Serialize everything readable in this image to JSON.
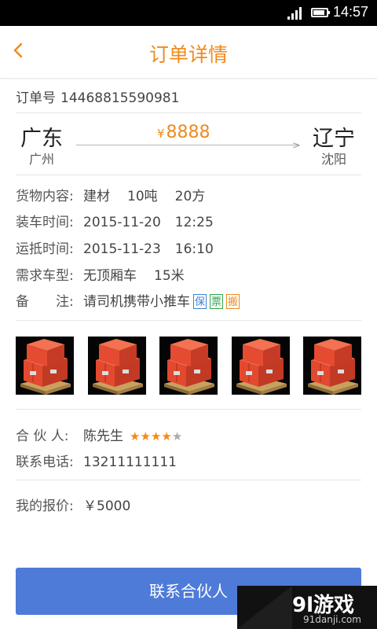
{
  "status_bar": {
    "time": "14:57"
  },
  "header": {
    "title": "订单详情"
  },
  "order": {
    "label": "订单号",
    "number": "14468815590981"
  },
  "route": {
    "from_province": "广东",
    "from_city": "广州",
    "to_province": "辽宁",
    "to_city": "沈阳",
    "currency": "¥",
    "price": "8888"
  },
  "details": {
    "cargo_label": "货物内容:",
    "cargo_type": "建材",
    "cargo_weight": "10吨",
    "cargo_volume": "20方",
    "load_label": "装车时间:",
    "load_date": "2015-11-20",
    "load_time": "12:25",
    "arrive_label": "运抵时间:",
    "arrive_date": "2015-11-23",
    "arrive_time": "16:10",
    "vehicle_label": "需求车型:",
    "vehicle_type": "无顶厢车",
    "vehicle_length": "15米",
    "note_label": "备　　注:",
    "note_text": "请司机携带小推车",
    "tags": [
      "保",
      "票",
      "搬"
    ]
  },
  "partner": {
    "label": "合 伙 人:",
    "name": "陈先生",
    "rating": 4,
    "rating_max": 5,
    "phone_label": "联系电话:",
    "phone": "13211111111"
  },
  "my_quote": {
    "label": "我的报价:",
    "value": "￥5000"
  },
  "contact_button": {
    "label": "联系合伙人"
  },
  "watermark": {
    "logo": "9l游戏",
    "url": "91danji.com"
  },
  "colors": {
    "accent": "#f08a1c",
    "button": "#4e7ad8"
  }
}
